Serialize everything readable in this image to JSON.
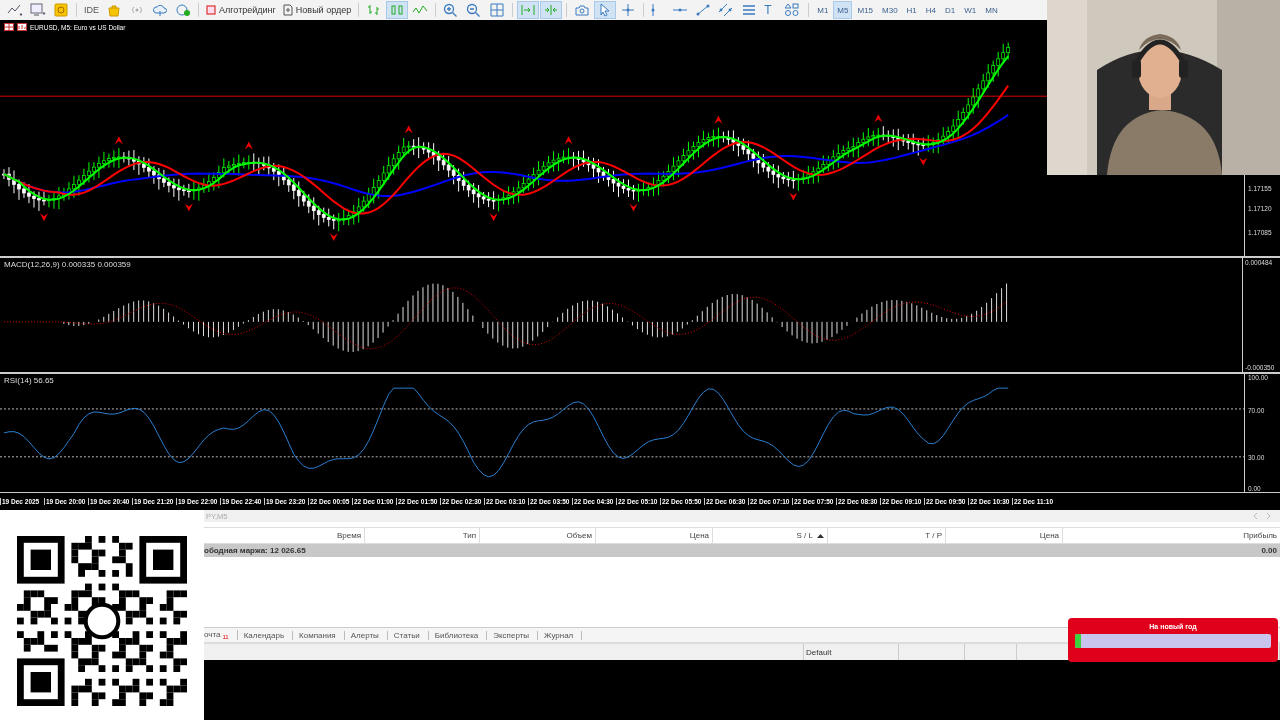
{
  "toolbar": {
    "groups": [
      [
        {
          "kind": "line-dropdown",
          "pressed": false
        },
        {
          "kind": "template",
          "pressed": false
        },
        {
          "kind": "coin",
          "pressed": false
        }
      ],
      [
        {
          "kind": "ide",
          "label": "IDE",
          "pressed": false
        },
        {
          "kind": "bag",
          "pressed": false
        },
        {
          "kind": "signal",
          "pressed": false
        },
        {
          "kind": "cloud",
          "pressed": false
        },
        {
          "kind": "vps",
          "pressed": false
        }
      ],
      [
        {
          "kind": "algo",
          "label": "Алготрейдинг",
          "pressed": false
        },
        {
          "kind": "order",
          "label": "Новый ордер",
          "pressed": false
        }
      ],
      [
        {
          "kind": "bars",
          "pressed": false
        },
        {
          "kind": "candles",
          "pressed": true
        },
        {
          "kind": "line",
          "pressed": false
        }
      ],
      [
        {
          "kind": "zoom-in",
          "pressed": false
        },
        {
          "kind": "zoom-out",
          "pressed": false
        },
        {
          "kind": "grid",
          "pressed": false
        }
      ],
      [
        {
          "kind": "autoscroll",
          "pressed": true
        },
        {
          "kind": "shift",
          "pressed": true
        }
      ],
      [
        {
          "kind": "camera",
          "pressed": false
        },
        {
          "kind": "cursor",
          "pressed": true
        },
        {
          "kind": "crosshair",
          "pressed": false
        }
      ],
      [
        {
          "kind": "vline",
          "pressed": false
        },
        {
          "kind": "hline",
          "pressed": false
        },
        {
          "kind": "trend",
          "pressed": false
        },
        {
          "kind": "channel",
          "pressed": false
        },
        {
          "kind": "fibo",
          "pressed": false
        },
        {
          "kind": "text",
          "label": "T",
          "pressed": false
        },
        {
          "kind": "shapes",
          "pressed": false
        }
      ]
    ],
    "timeframes": [
      {
        "label": "M1",
        "selected": false
      },
      {
        "label": "M5",
        "selected": true
      },
      {
        "label": "M15",
        "selected": false
      },
      {
        "label": "M30",
        "selected": false
      },
      {
        "label": "H1",
        "selected": false
      },
      {
        "label": "H4",
        "selected": false
      },
      {
        "label": "D1",
        "selected": false
      },
      {
        "label": "W1",
        "selected": false
      },
      {
        "label": "MN",
        "selected": false
      }
    ]
  },
  "chart": {
    "title": "EURUSD, M5:  Euro vs US Dollar",
    "price_labels": [
      "1.17155",
      "1.17120",
      "1.17085"
    ],
    "macd": {
      "title": "MACD(12,26,9) 0.000335 0.000359",
      "labels": [
        "0.000484",
        "-0.000350"
      ]
    },
    "rsi": {
      "title": "RSI(14) 56.65",
      "labels": [
        "100.00",
        "70.00",
        "30.00",
        "0.00"
      ]
    },
    "time_labels": [
      "19 Dec 2025",
      "19 Dec 20:00",
      "19 Dec 20:40",
      "19 Dec 21:20",
      "19 Dec 22:00",
      "19 Dec 22:40",
      "19 Dec 23:20",
      "22 Dec 00:05",
      "22 Dec 01:00",
      "22 Dec 01:50",
      "22 Dec 02:30",
      "22 Dec 03:10",
      "22 Dec 03:50",
      "22 Dec 04:30",
      "22 Dec 05:10",
      "22 Dec 05:50",
      "22 Dec 06:30",
      "22 Dec 07:10",
      "22 Dec 07:50",
      "22 Dec 08:30",
      "22 Dec 09:10",
      "22 Dec 09:50",
      "22 Dec 10:30",
      "22 Dec 11:10"
    ]
  },
  "symbol_tabs": [
    {
      "label": "PY,M5",
      "selected": false
    }
  ],
  "trade": {
    "columns": [
      "Время",
      "Тип",
      "Объем",
      "Цена",
      "S / L",
      "T / P",
      "Цена",
      "Прибыль"
    ],
    "summary": {
      "text": "ободная маржа: 12 026.65",
      "profit": "0.00"
    }
  },
  "bottom_tabs": [
    {
      "label": "очта",
      "badge": "11",
      "selected": false
    },
    {
      "label": "Календарь",
      "selected": false
    },
    {
      "label": "Компания",
      "selected": false
    },
    {
      "label": "Алерты",
      "selected": false
    },
    {
      "label": "Статьи",
      "selected": false
    },
    {
      "label": "Библиотека",
      "selected": false
    },
    {
      "label": "Эксперты",
      "selected": false
    },
    {
      "label": "Журнал",
      "selected": false
    }
  ],
  "status_bar": {
    "profile": "Default"
  },
  "promo": {
    "title": "На новый год",
    "level": 0.03
  }
}
